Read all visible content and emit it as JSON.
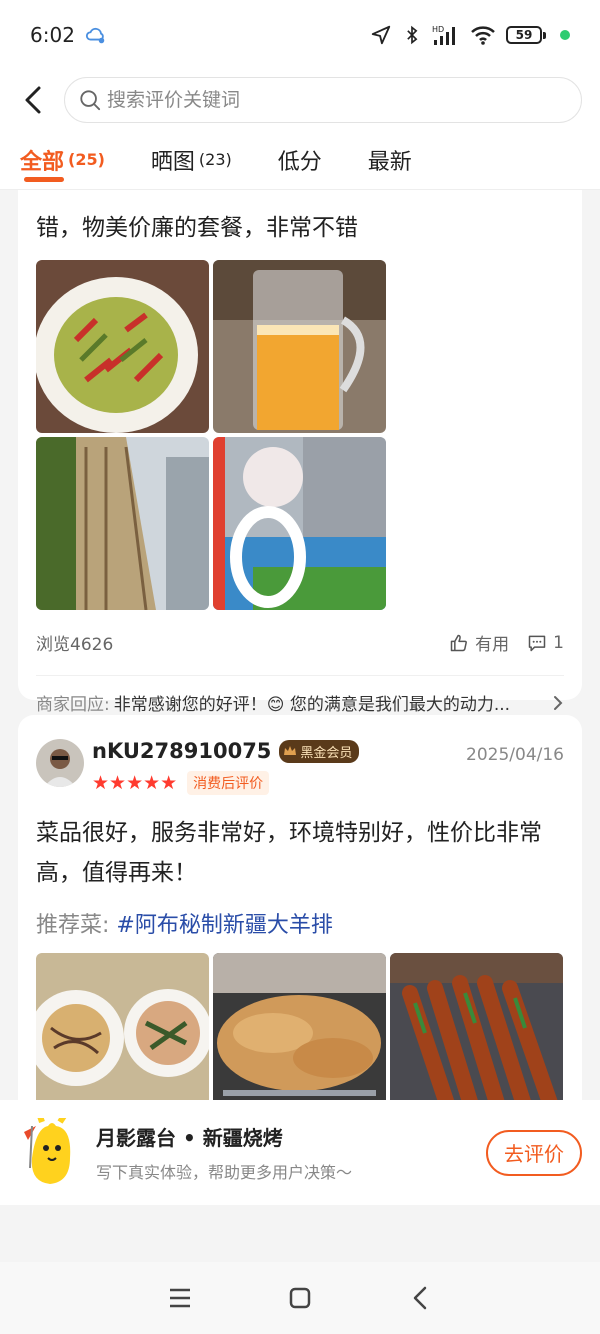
{
  "status_bar": {
    "time": "6:02",
    "battery": "59"
  },
  "search": {
    "placeholder": "搜索评价关键词"
  },
  "tabs": [
    {
      "label": "全部",
      "count": "(25)"
    },
    {
      "label": "晒图",
      "count": "(23)"
    },
    {
      "label": "低分",
      "count": ""
    },
    {
      "label": "最新",
      "count": ""
    }
  ],
  "review1": {
    "text": "错，物美价廉的套餐，非常不错",
    "views": "浏览4626",
    "useful_label": "有用",
    "comment_count": "1",
    "reply_label": "商家回应:",
    "reply_text": "非常感谢您的好评！😊 您的满意是我们最大的动力..."
  },
  "review2": {
    "username": "nKU278910075",
    "vip_label": "黑金会员",
    "stars": "★★★★★",
    "after_label": "消费后评价",
    "date": "2025/04/16",
    "text": "菜品很好，服务非常好，环境特别好，性价比非常高，值得再来！",
    "recommend_label": "推荐菜:",
    "recommend_dish": "#阿布秘制新疆大羊排"
  },
  "cta": {
    "title": "月影露台 • 新疆烧烤",
    "subtitle": "写下真实体验，帮助更多用户决策～",
    "button": "去评价"
  },
  "colors": {
    "accent": "#f25c20",
    "link": "#2a4da8",
    "star": "#ff3b2f"
  }
}
